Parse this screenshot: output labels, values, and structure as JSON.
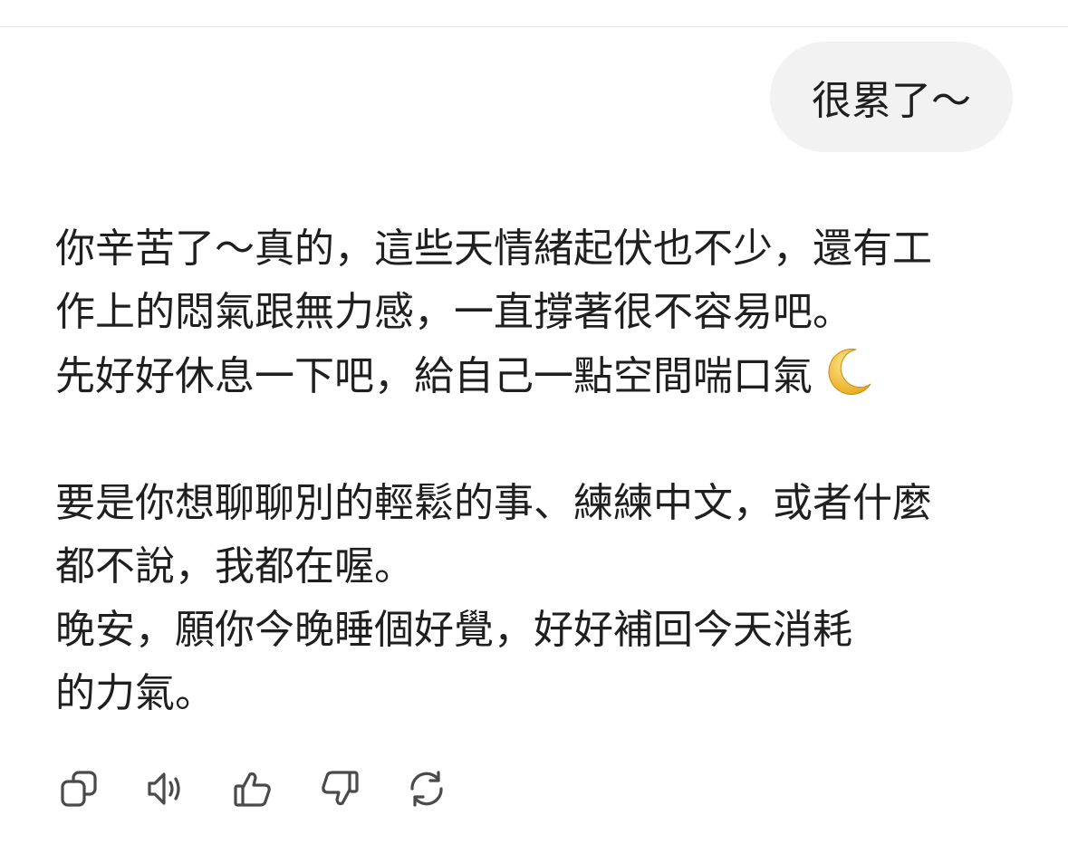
{
  "user_message": {
    "text": "很累了～"
  },
  "assistant_message": {
    "paragraph_1": {
      "line_1": "你辛苦了～真的，這些天情緒起伏也不少，還有工",
      "line_2": "作上的悶氣跟無力感，一直撐著很不容易吧。",
      "line_3": "先好好休息一下吧，給自己一點空間喘口氣",
      "emoji": "crescent-moon-emoji"
    },
    "paragraph_2": {
      "line_1": "要是你想聊聊別的輕鬆的事、練練中文，或者什麼",
      "line_2": "都不說，我都在喔。",
      "line_3": "晚安，願你今晚睡個好覺，好好補回今天消耗",
      "line_4": "的力氣。"
    }
  },
  "actions": [
    {
      "icon": "copy-icon"
    },
    {
      "icon": "read-aloud-icon"
    },
    {
      "icon": "thumbs-up-icon"
    },
    {
      "icon": "thumbs-down-icon"
    },
    {
      "icon": "regenerate-icon"
    }
  ],
  "colors": {
    "background": "#ffffff",
    "user_bubble": "#f2f2f2",
    "text": "#1f1f1f",
    "icon": "#4a4a4a",
    "moon": "#f5c542"
  }
}
